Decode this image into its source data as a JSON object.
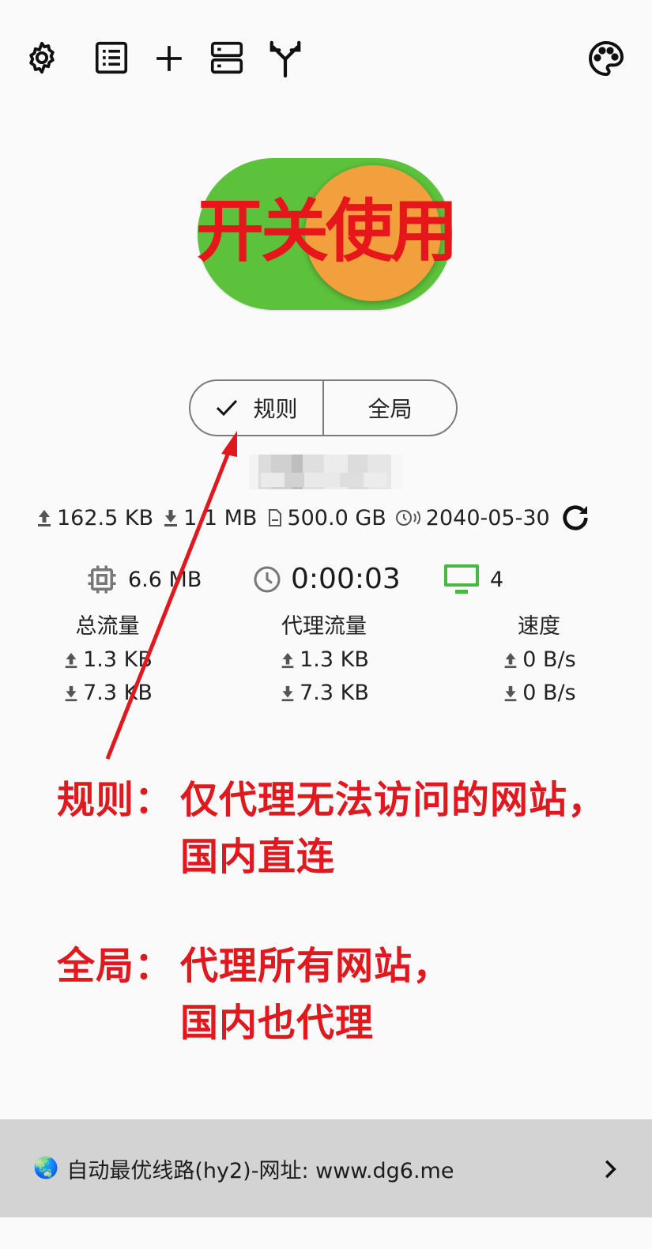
{
  "toolbar": {
    "icons": [
      "gear-icon",
      "list-icon",
      "plus-icon",
      "server-icon",
      "fork-icon",
      "palette-icon"
    ]
  },
  "toggle": {
    "state": "on",
    "overlay_text": "开关使用",
    "track_color": "#5cc23b",
    "knob_color": "#f2a03d"
  },
  "mode": {
    "rule_label": "规则",
    "global_label": "全局",
    "selected": "规则"
  },
  "stats": {
    "upload": "162.5 KB",
    "download": "1.1 MB",
    "quota": "500.0 GB",
    "expire": "2040-05-30"
  },
  "system": {
    "memory": "6.6 MB",
    "uptime": "0:00:03",
    "connections": "4"
  },
  "traffic": {
    "total": {
      "label": "总流量",
      "up": "1.3 KB",
      "down": "7.3 KB"
    },
    "proxy": {
      "label": "代理流量",
      "up": "1.3 KB",
      "down": "7.3 KB"
    },
    "speed": {
      "label": "速度",
      "up": "0 B/s",
      "down": "0 B/s"
    }
  },
  "annotation": {
    "rule_title": "规则：",
    "rule_line1": "仅代理无法访问的网站，",
    "rule_line2": "国内直连",
    "global_title": "全局：",
    "global_line1": "代理所有网站，",
    "global_line2": "国内也代理",
    "color": "#e1191e"
  },
  "footer": {
    "emoji": "🌏",
    "server_name": "自动最优线路(hy2)-网址: www.dg6.me"
  }
}
